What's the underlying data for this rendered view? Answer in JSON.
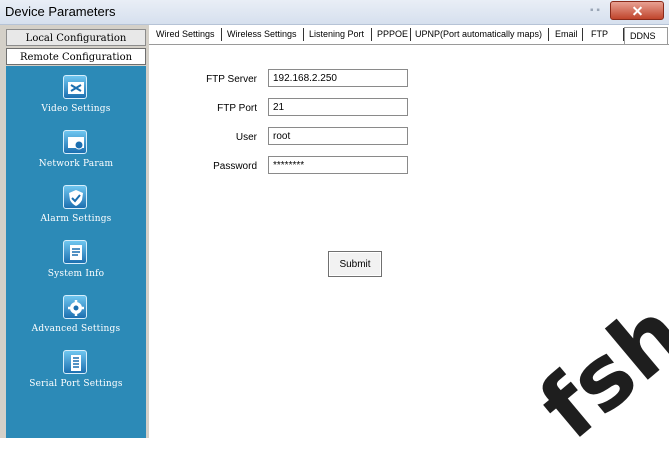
{
  "window": {
    "title": "Device Parameters"
  },
  "sidebar": {
    "local_label": "Local Configuration",
    "remote_label": "Remote Configuration",
    "items": [
      {
        "label": "Video Settings",
        "icon": "video-settings-icon"
      },
      {
        "label": "Network Param",
        "icon": "network-icon"
      },
      {
        "label": "Alarm Settings",
        "icon": "shield-icon"
      },
      {
        "label": "System Info",
        "icon": "system-info-icon"
      },
      {
        "label": "Advanced Settings",
        "icon": "gear-icon"
      },
      {
        "label": "Serial Port Settings",
        "icon": "serial-port-icon"
      }
    ]
  },
  "tabs": [
    "Wired Settings",
    "Wireless Settings",
    "Listening Port",
    "PPPOE",
    "UPNP(Port automatically maps)",
    "Email",
    "FTP",
    "DDNS"
  ],
  "active_tab": "FTP",
  "form": {
    "ftp_server_label": "FTP Server",
    "ftp_server_value": "192.168.2.250",
    "ftp_port_label": "FTP Port",
    "ftp_port_value": "21",
    "user_label": "User",
    "user_value": "root",
    "password_label": "Password",
    "password_value": "********",
    "submit_label": "Submit"
  },
  "watermark": "fshop.ru",
  "colors": {
    "sidebar_panel": "#2c8ab7",
    "close_button": "#c0452c"
  }
}
